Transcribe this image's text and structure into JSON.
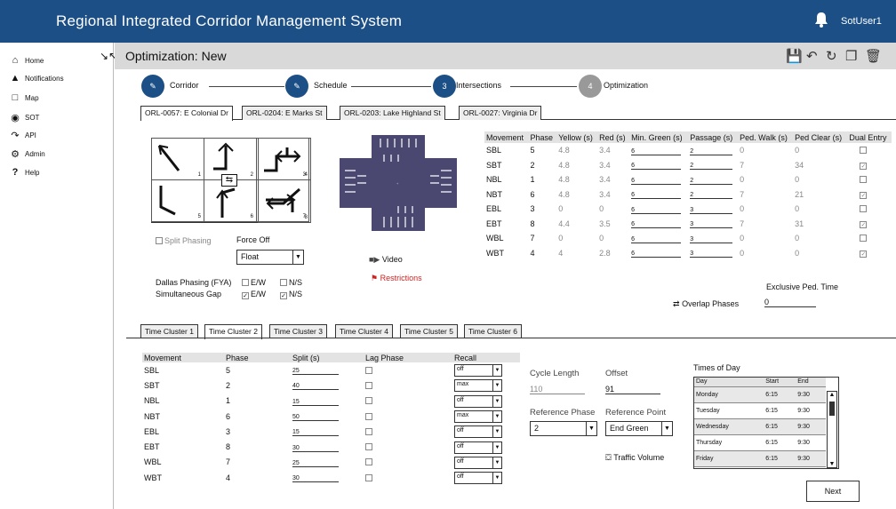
{
  "header": {
    "title": "Regional Integrated Corridor Management System",
    "user": "SotUser1"
  },
  "sidebar": {
    "items": [
      {
        "label": "Home",
        "icon": "home-icon"
      },
      {
        "label": "Notifications",
        "icon": "bell-icon"
      },
      {
        "label": "Map",
        "icon": "map-icon"
      },
      {
        "label": "SOT",
        "icon": "binoculars-icon"
      },
      {
        "label": "API",
        "icon": "share-icon"
      },
      {
        "label": "Admin",
        "icon": "gear-icon"
      },
      {
        "label": "Help",
        "icon": "help-icon"
      }
    ]
  },
  "page": {
    "title": "Optimization: New"
  },
  "wizard": {
    "steps": [
      {
        "number": "",
        "label": "Corridor"
      },
      {
        "number": "",
        "label": "Schedule"
      },
      {
        "number": "3",
        "label": "Intersections"
      },
      {
        "number": "4",
        "label": "Optimization"
      }
    ]
  },
  "intersection_tabs": [
    "ORL-0057: E Colonial Dr",
    "ORL-0204: E Marks St",
    "ORL-0203: Lake Highland St",
    "ORL-0027: Virginia Dr"
  ],
  "phase_grid": {
    "numbers": [
      "1",
      "2",
      "3",
      "4",
      "5",
      "6",
      "7",
      "8"
    ]
  },
  "controls": {
    "split_phasing": "Split Phasing",
    "force_off": "Force Off",
    "force_off_value": "Float",
    "video": "Video",
    "restrictions": "Restrictions",
    "dallas_label": "Dallas Phasing (FYA)",
    "simul_label": "Simultaneous Gap",
    "ew": "E/W",
    "ns": "N/S",
    "overlap": "Overlap Phases",
    "exclusive_label": "Exclusive Ped. Time",
    "exclusive_value": "0"
  },
  "phase_table": {
    "headers": [
      "Movement",
      "Phase",
      "Yellow (s)",
      "Red (s)",
      "Min. Green (s)",
      "Passage (s)",
      "Ped. Walk (s)",
      "Ped Clear (s)",
      "Dual Entry"
    ],
    "rows": [
      [
        "SBL",
        "5",
        "4.8",
        "3.4",
        "6",
        "2",
        "0",
        "0",
        false
      ],
      [
        "SBT",
        "2",
        "4.8",
        "3.4",
        "6",
        "2",
        "7",
        "34",
        true
      ],
      [
        "NBL",
        "1",
        "4.8",
        "3.4",
        "6",
        "2",
        "0",
        "0",
        false
      ],
      [
        "NBT",
        "6",
        "4.8",
        "3.4",
        "6",
        "2",
        "7",
        "21",
        true
      ],
      [
        "EBL",
        "3",
        "0",
        "0",
        "6",
        "3",
        "0",
        "0",
        false
      ],
      [
        "EBT",
        "8",
        "4.4",
        "3.5",
        "6",
        "3",
        "7",
        "31",
        true
      ],
      [
        "WBL",
        "7",
        "0",
        "0",
        "6",
        "3",
        "0",
        "0",
        false
      ],
      [
        "WBT",
        "4",
        "4",
        "2.8",
        "6",
        "3",
        "0",
        "0",
        true
      ]
    ]
  },
  "cluster_tabs": [
    "Time Cluster 1",
    "Time Cluster 2",
    "Time Cluster 3",
    "Time Cluster 4",
    "Time Cluster 5",
    "Time Cluster 6"
  ],
  "cluster_table": {
    "headers": [
      "Movement",
      "Phase",
      "Split (s)",
      "Lag Phase",
      "Recall"
    ],
    "rows": [
      [
        "SBL",
        "5",
        "25",
        "off"
      ],
      [
        "SBT",
        "2",
        "40",
        "max"
      ],
      [
        "NBL",
        "1",
        "15",
        "off"
      ],
      [
        "NBT",
        "6",
        "50",
        "max"
      ],
      [
        "EBL",
        "3",
        "15",
        "off"
      ],
      [
        "EBT",
        "8",
        "30",
        "off"
      ],
      [
        "WBL",
        "7",
        "25",
        "off"
      ],
      [
        "WBT",
        "4",
        "30",
        "off"
      ]
    ]
  },
  "timing": {
    "cycle_label": "Cycle Length",
    "cycle_value": "110",
    "offset_label": "Offset",
    "offset_value": "91",
    "ref_phase_label": "Reference Phase",
    "ref_phase_value": "2",
    "ref_point_label": "Reference Point",
    "ref_point_value": "End Green",
    "traffic_volume": "Traffic Volume"
  },
  "times_of_day": {
    "title": "Times of Day",
    "headers": [
      "Day",
      "Start",
      "End"
    ],
    "rows": [
      [
        "Monday",
        "6:15",
        "9:30"
      ],
      [
        "Tuesday",
        "6:15",
        "9:30"
      ],
      [
        "Wednesday",
        "6:15",
        "9:30"
      ],
      [
        "Thursday",
        "6:15",
        "9:30"
      ],
      [
        "Friday",
        "6:15",
        "9:30"
      ]
    ]
  },
  "buttons": {
    "next": "Next"
  },
  "colors": {
    "header": "#1c4f86",
    "step_done": "#1c4f86",
    "step_pending": "#999999",
    "restriction": "#cc2222"
  }
}
